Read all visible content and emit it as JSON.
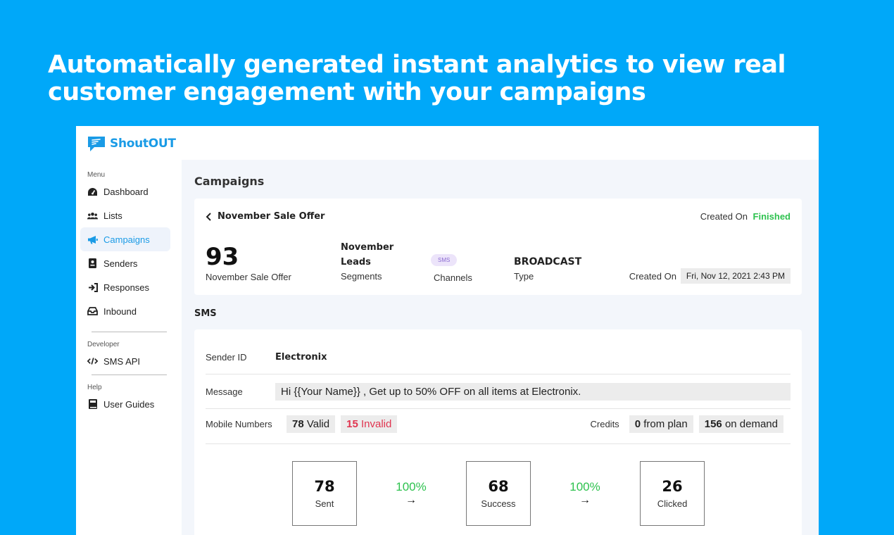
{
  "hero": {
    "line1": "Automatically generated instant analytics to view real",
    "line2": "customer engagement with your campaigns"
  },
  "brand": {
    "name": "ShoutOUT",
    "color": "#1a9be6"
  },
  "sidebar": {
    "menu_label": "Menu",
    "items": [
      {
        "label": "Dashboard",
        "icon": "dashboard-icon"
      },
      {
        "label": "Lists",
        "icon": "users-icon"
      },
      {
        "label": "Campaigns",
        "icon": "megaphone-icon"
      },
      {
        "label": "Senders",
        "icon": "id-card-icon"
      },
      {
        "label": "Responses",
        "icon": "sign-in-icon"
      },
      {
        "label": "Inbound",
        "icon": "inbox-icon"
      }
    ],
    "developer_label": "Developer",
    "developer_items": [
      {
        "label": "SMS API",
        "icon": "code-icon"
      }
    ],
    "help_label": "Help",
    "help_items": [
      {
        "label": "User Guides",
        "icon": "book-icon"
      }
    ]
  },
  "main": {
    "title": "Campaigns",
    "campaign": {
      "name": "November Sale Offer",
      "created_on_label": "Created On",
      "status": "Finished",
      "total": "93",
      "total_label": "November Sale Offer",
      "segments_value_line1": "November",
      "segments_value_line2": "Leads",
      "segments_label": "Segments",
      "channel_pill": "SMS",
      "channels_label": "Channels",
      "type_value": "BROADCAST",
      "type_label": "Type",
      "created_label": "Created On",
      "created_date": "Fri, Nov 12, 2021 2:43 PM"
    },
    "sms": {
      "title": "SMS",
      "sender_id_label": "Sender ID",
      "sender_id": "Electronix",
      "message_label": "Message",
      "message": "Hi  {{Your Name}} , Get up to 50% OFF on all items at Electronix.",
      "mobile_label": "Mobile Numbers",
      "valid_count": "78",
      "valid_label": "Valid",
      "invalid_count": "15",
      "invalid_label": "Invalid",
      "credits_label": "Credits",
      "plan_count": "0",
      "plan_label": "from plan",
      "demand_count": "156",
      "demand_label": "on demand"
    },
    "funnel": {
      "sent": "78",
      "sent_label": "Sent",
      "pct1": "100%",
      "success": "68",
      "success_label": "Success",
      "pct2": "100%",
      "clicked": "26",
      "clicked_label": "Clicked"
    }
  },
  "colors": {
    "background": "#00a8f9",
    "accent": "#1a9be6",
    "finished": "#2ec24f",
    "invalid": "#e0344f"
  }
}
